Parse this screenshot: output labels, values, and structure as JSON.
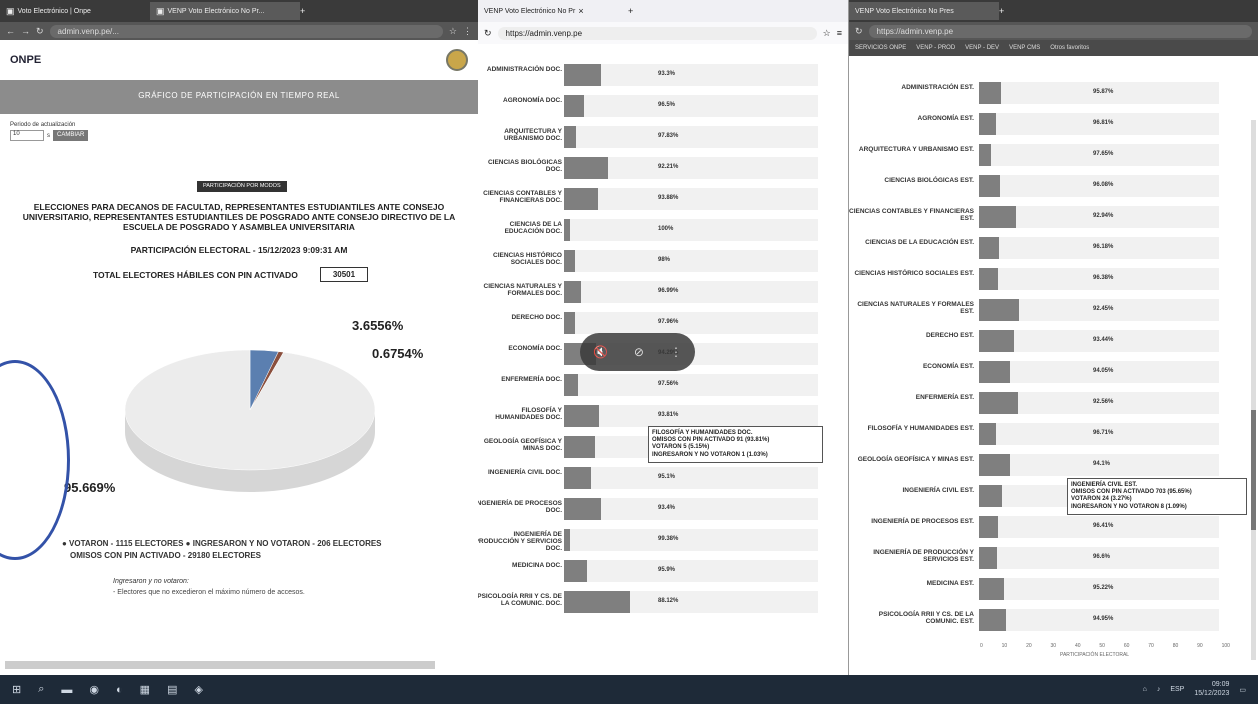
{
  "win1": {
    "tabs": [
      "Voto Electrónico | Onpe",
      "VENP Voto Electrónico No Pr..."
    ],
    "url": "admin.venp.pe/..."
  },
  "win2": {
    "tab": "VENP Voto Electrónico No Pr",
    "url": "https://admin.venp.pe"
  },
  "win3": {
    "tab": "VENP Voto Electrónico No Pres",
    "url": "https://admin.venp.pe",
    "bookmarks": [
      "SERVICIOS ONPE",
      "VENP - PROD",
      "VENP - DEV",
      "VENP CMS",
      "Otros favoritos"
    ]
  },
  "onpe": {
    "logo": "ONPE",
    "banner": "GRÁFICO DE PARTICIPACIÓN EN TIEMPO REAL",
    "refresh_label": "Periodo de actualización",
    "refresh_value": "10",
    "refresh_unit": "s",
    "change_button": "CAMBIAR",
    "by_college_button": "PARTICIPACIÓN POR MODOS",
    "title": "ELECCIONES PARA DECANOS DE FACULTAD, REPRESENTANTES ESTUDIANTILES ANTE CONSEJO UNIVERSITARIO, REPRESENTANTES ESTUDIANTILES DE POSGRADO ANTE CONSEJO DIRECTIVO DE LA ESCUELA DE POSGRADO Y ASAMBLEA UNIVERSITARIA",
    "participation": "PARTICIPACIÓN ELECTORAL - 15/12/2023 9:09:31 AM",
    "total_label": "TOTAL ELECTORES HÁBILES CON PIN ACTIVADO",
    "total_value": "30501",
    "legend_line1": "● VOTARON - 1115 ELECTORES   ● INGRESARON Y NO VOTARON - 206 ELECTORES",
    "legend_line2": "OMISOS CON PIN ACTIVADO - 29180 ELECTORES",
    "note_title": "Ingresaron y no votaron:",
    "note_text": "- Electores que no excedieron el máximo número de accesos."
  },
  "chart_data": [
    {
      "type": "pie",
      "labels": [
        "VOTARON",
        "INGRESARON Y NO VOTARON",
        "OMISOS CON PIN ACTIVADO"
      ],
      "values": [
        3.6556,
        0.6754,
        95.669
      ],
      "value_labels": [
        "3.6556%",
        "0.6754%",
        "95.669%"
      ],
      "colors": [
        "#5b7fb0",
        "#8a4f3d",
        "#ececec"
      ]
    },
    {
      "type": "bar",
      "orientation": "horizontal",
      "categories": [
        "ADMINISTRACIÓN DOC.",
        "AGRONOMÍA DOC.",
        "ARQUITECTURA Y URBANISMO DOC.",
        "CIENCIAS BIOLÓGICAS DOC.",
        "CIENCIAS CONTABLES Y FINANCIERAS DOC.",
        "CIENCIAS DE LA EDUCACIÓN DOC.",
        "CIENCIAS HISTÓRICO SOCIALES DOC.",
        "CIENCIAS NATURALES Y FORMALES DOC.",
        "DERECHO DOC.",
        "ECONOMÍA DOC.",
        "ENFERMERÍA DOC.",
        "FILOSOFÍA Y HUMANIDADES DOC.",
        "GEOLOGÍA GEOFÍSICA Y MINAS DOC.",
        "INGENIERÍA CIVIL DOC.",
        "INGENIERÍA DE PROCESOS DOC.",
        "INGENIERÍA DE PRODUCCIÓN Y SERVICIOS DOC.",
        "MEDICINA DOC.",
        "PSICOLOGÍA RRII Y CS. DE LA COMUNIC. DOC."
      ],
      "value_labels": [
        "93.3%",
        "96.5%",
        "97.83%",
        "92.21%",
        "93.88%",
        "100%",
        "98%",
        "96.99%",
        "97.96%",
        "94.29%",
        "97.56%",
        "93.81%",
        "94.44%",
        "95.1%",
        "93.4%",
        "99.38%",
        "95.9%",
        "88.12%"
      ],
      "values": [
        93.3,
        96.5,
        97.83,
        92.21,
        93.88,
        100,
        98,
        96.99,
        97.96,
        94.29,
        97.56,
        93.81,
        94.44,
        95.1,
        93.4,
        99.38,
        95.9,
        88.12
      ],
      "tooltip": [
        "FILOSOFÍA Y HUMANIDADES DOC.",
        "OMISOS CON PIN ACTIVADO 91 (93.81%)",
        "VOTARON 5 (5.15%)",
        "INGRESARON Y NO VOTARON 1 (1.03%)"
      ]
    },
    {
      "type": "bar",
      "orientation": "horizontal",
      "categories": [
        "ADMINISTRACIÓN EST.",
        "AGRONOMÍA EST.",
        "ARQUITECTURA Y URBANISMO EST.",
        "CIENCIAS BIOLÓGICAS EST.",
        "CIENCIAS CONTABLES Y FINANCIERAS EST.",
        "CIENCIAS DE LA EDUCACIÓN EST.",
        "CIENCIAS HISTÓRICO SOCIALES EST.",
        "CIENCIAS NATURALES Y FORMALES EST.",
        "DERECHO EST.",
        "ECONOMÍA EST.",
        "ENFERMERÍA EST.",
        "FILOSOFÍA Y HUMANIDADES EST.",
        "GEOLOGÍA GEOFÍSICA Y MINAS EST.",
        "INGENIERÍA CIVIL EST.",
        "INGENIERÍA DE PROCESOS EST.",
        "INGENIERÍA DE PRODUCCIÓN Y SERVICIOS EST.",
        "MEDICINA EST.",
        "PSICOLOGÍA RRII Y CS. DE LA COMUNIC. EST."
      ],
      "value_labels": [
        "95.87%",
        "96.81%",
        "97.65%",
        "96.08%",
        "92.94%",
        "96.18%",
        "96.38%",
        "92.45%",
        "93.44%",
        "94.05%",
        "92.56%",
        "96.71%",
        "94.1%",
        "95.65%",
        "96.41%",
        "96.6%",
        "95.22%",
        "94.95%"
      ],
      "values": [
        95.87,
        96.81,
        97.65,
        96.08,
        92.94,
        96.18,
        96.38,
        92.45,
        93.44,
        94.05,
        92.56,
        96.71,
        94.1,
        95.65,
        96.41,
        96.6,
        95.22,
        94.95
      ],
      "xlabel": "PARTICIPACIÓN ELECTORAL",
      "xticks": [
        "0",
        "10",
        "20",
        "30",
        "40",
        "50",
        "60",
        "70",
        "80",
        "90",
        "100"
      ],
      "tooltip": [
        "INGENIERÍA CIVIL EST.",
        "OMISOS CON PIN ACTIVADO 703 (95.65%)",
        "VOTARON 24 (3.27%)",
        "INGRESARON Y NO VOTARON 8 (1.09%)"
      ]
    }
  ],
  "taskbar": {
    "language": "ESP",
    "time": "09:09",
    "date": "15/12/2023"
  }
}
